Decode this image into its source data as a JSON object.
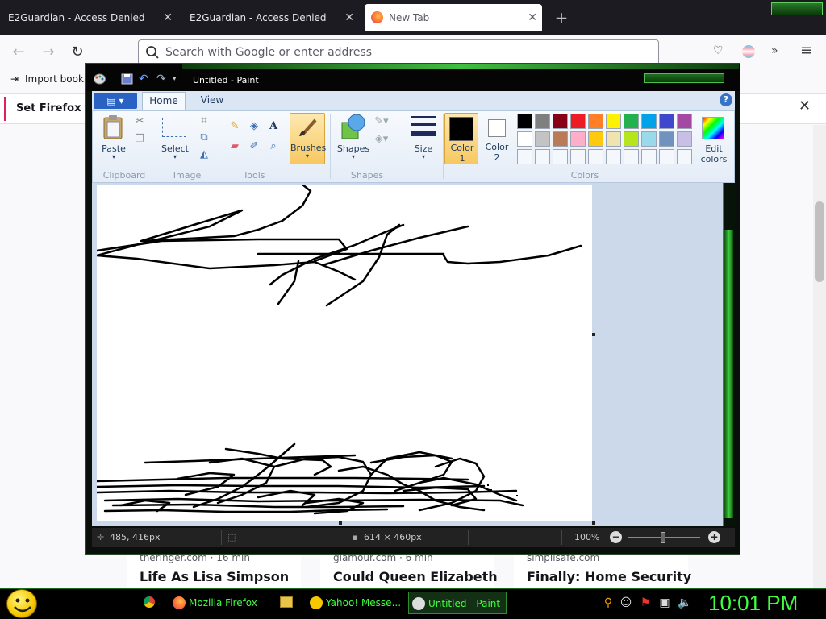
{
  "browser": {
    "tabs": [
      {
        "title": "E2Guardian - Access Denied"
      },
      {
        "title": "E2Guardian - Access Denied"
      },
      {
        "title": "New Tab"
      }
    ],
    "url_placeholder": "Search with Google or enter address",
    "bookmarks_label": "Import bookn",
    "notification_text": "Set Firefox as y",
    "cards": [
      {
        "source": "theringer.com · 16 min",
        "title": "Life As Lisa Simpson"
      },
      {
        "source": "glamour.com · 6 min",
        "title": "Could Queen Elizabeth"
      },
      {
        "source": "simplisafe.com",
        "title": "Finally: Home Security"
      }
    ]
  },
  "paint": {
    "title": "Untitled - Paint",
    "tabs": {
      "home": "Home",
      "view": "View"
    },
    "groups": {
      "clipboard": "Clipboard",
      "image": "Image",
      "tools": "Tools",
      "shapes": "Shapes",
      "colors": "Colors"
    },
    "buttons": {
      "paste": "Paste",
      "select": "Select",
      "brushes": "Brushes",
      "shapes": "Shapes",
      "size": "Size",
      "color1_line1": "Color",
      "color1_line2": "1",
      "color2_line1": "Color",
      "color2_line2": "2",
      "edit_colors_line1": "Edit",
      "edit_colors_line2": "colors"
    },
    "palette_row1": [
      "#000000",
      "#7f7f7f",
      "#880015",
      "#ed1c24",
      "#ff7f27",
      "#fff200",
      "#22b14c",
      "#00a2e8",
      "#3f48cc",
      "#a349a4"
    ],
    "palette_row2": [
      "#ffffff",
      "#c3c3c3",
      "#b97a57",
      "#ffaec9",
      "#ffc90e",
      "#efe4b0",
      "#b5e61d",
      "#99d9ea",
      "#7092be",
      "#c8bfe7"
    ],
    "color1": "#000000",
    "color2": "#ffffff",
    "status": {
      "cursor_pos": "485, 416px",
      "canvas_size": "614 × 460px",
      "zoom": "100%"
    }
  },
  "taskbar": {
    "items": [
      {
        "label": "Mozilla Firefox"
      },
      {
        "label": "Yahoo! Messe..."
      },
      {
        "label": "Untitled - Paint"
      }
    ],
    "clock": "10:01 PM"
  }
}
